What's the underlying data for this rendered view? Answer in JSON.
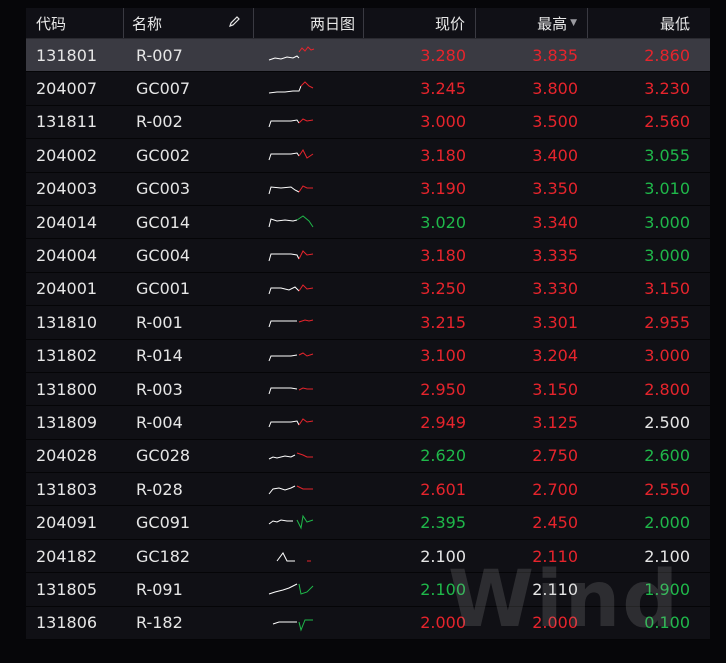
{
  "columns": {
    "code": "代码",
    "name": "名称",
    "chart": "两日图",
    "price": "现价",
    "high": "最高",
    "low": "最低"
  },
  "icons": {
    "edit": "pencil-icon",
    "sort": "sort-down-icon"
  },
  "colors": {
    "up": "#e6242c",
    "down": "#1fb84a",
    "flat": "#e6e6e6",
    "selected_row": "#3a3a42"
  },
  "rows": [
    {
      "code": "131801",
      "name": "R-007",
      "price": "3.280",
      "high": "3.835",
      "low": "2.860",
      "pc": "red",
      "hc": "red",
      "lc": "red"
    },
    {
      "code": "204007",
      "name": "GC007",
      "price": "3.245",
      "high": "3.800",
      "low": "3.230",
      "pc": "red",
      "hc": "red",
      "lc": "red"
    },
    {
      "code": "131811",
      "name": "R-002",
      "price": "3.000",
      "high": "3.500",
      "low": "2.560",
      "pc": "red",
      "hc": "red",
      "lc": "red"
    },
    {
      "code": "204002",
      "name": "GC002",
      "price": "3.180",
      "high": "3.400",
      "low": "3.055",
      "pc": "red",
      "hc": "red",
      "lc": "green"
    },
    {
      "code": "204003",
      "name": "GC003",
      "price": "3.190",
      "high": "3.350",
      "low": "3.010",
      "pc": "red",
      "hc": "red",
      "lc": "green"
    },
    {
      "code": "204014",
      "name": "GC014",
      "price": "3.020",
      "high": "3.340",
      "low": "3.000",
      "pc": "green",
      "hc": "red",
      "lc": "green"
    },
    {
      "code": "204004",
      "name": "GC004",
      "price": "3.180",
      "high": "3.335",
      "low": "3.000",
      "pc": "red",
      "hc": "red",
      "lc": "green"
    },
    {
      "code": "204001",
      "name": "GC001",
      "price": "3.250",
      "high": "3.330",
      "low": "3.150",
      "pc": "red",
      "hc": "red",
      "lc": "red"
    },
    {
      "code": "131810",
      "name": "R-001",
      "price": "3.215",
      "high": "3.301",
      "low": "2.955",
      "pc": "red",
      "hc": "red",
      "lc": "red"
    },
    {
      "code": "131802",
      "name": "R-014",
      "price": "3.100",
      "high": "3.204",
      "low": "3.000",
      "pc": "red",
      "hc": "red",
      "lc": "red"
    },
    {
      "code": "131800",
      "name": "R-003",
      "price": "2.950",
      "high": "3.150",
      "low": "2.800",
      "pc": "red",
      "hc": "red",
      "lc": "red"
    },
    {
      "code": "131809",
      "name": "R-004",
      "price": "2.949",
      "high": "3.125",
      "low": "2.500",
      "pc": "red",
      "hc": "red",
      "lc": "white"
    },
    {
      "code": "204028",
      "name": "GC028",
      "price": "2.620",
      "high": "2.750",
      "low": "2.600",
      "pc": "green",
      "hc": "red",
      "lc": "green"
    },
    {
      "code": "131803",
      "name": "R-028",
      "price": "2.601",
      "high": "2.700",
      "low": "2.550",
      "pc": "red",
      "hc": "red",
      "lc": "red"
    },
    {
      "code": "204091",
      "name": "GC091",
      "price": "2.395",
      "high": "2.450",
      "low": "2.000",
      "pc": "green",
      "hc": "red",
      "lc": "green"
    },
    {
      "code": "204182",
      "name": "GC182",
      "price": "2.100",
      "high": "2.110",
      "low": "2.100",
      "pc": "white",
      "hc": "red",
      "lc": "white"
    },
    {
      "code": "131805",
      "name": "R-091",
      "price": "2.100",
      "high": "2.110",
      "low": "1.900",
      "pc": "green",
      "hc": "white",
      "lc": "green"
    },
    {
      "code": "131806",
      "name": "R-182",
      "price": "2.000",
      "high": "2.000",
      "low": "0.100",
      "pc": "red",
      "hc": "red",
      "lc": "green"
    }
  ],
  "watermark": "Wind"
}
